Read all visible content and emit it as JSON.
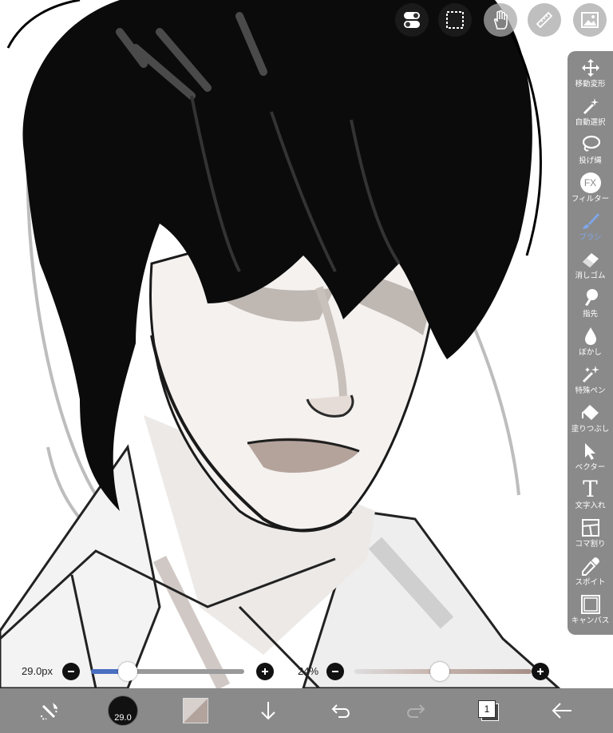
{
  "top_buttons": [
    {
      "name": "toggle-icon"
    },
    {
      "name": "selection-icon"
    },
    {
      "name": "hand-icon"
    },
    {
      "name": "ruler-icon"
    },
    {
      "name": "image-icon"
    }
  ],
  "tools": [
    {
      "label": "移動変形",
      "icon": "move-icon"
    },
    {
      "label": "自動選択",
      "icon": "magic-wand-icon"
    },
    {
      "label": "投げ縄",
      "icon": "lasso-icon"
    },
    {
      "label": "フィルター",
      "icon": "fx-icon"
    },
    {
      "label": "ブラシ",
      "icon": "brush-icon",
      "active": true
    },
    {
      "label": "消しゴム",
      "icon": "eraser-icon"
    },
    {
      "label": "指先",
      "icon": "finger-icon"
    },
    {
      "label": "ぼかし",
      "icon": "blur-icon"
    },
    {
      "label": "特殊ペン",
      "icon": "special-pen-icon"
    },
    {
      "label": "塗りつぶし",
      "icon": "fill-icon"
    },
    {
      "label": "ベクター",
      "icon": "vector-icon"
    },
    {
      "label": "文字入れ",
      "icon": "text-icon"
    },
    {
      "label": "コマ割り",
      "icon": "frame-divider-icon"
    },
    {
      "label": "スポイト",
      "icon": "eyedropper-icon"
    },
    {
      "label": "キャンバス",
      "icon": "canvas-icon"
    }
  ],
  "fx_text": "FX",
  "text_tool_glyph": "T",
  "brush_size": {
    "label": "29.0px",
    "value": 29.0,
    "fraction": 0.24
  },
  "opacity": {
    "label": "24%",
    "value": 24,
    "fraction": 0.12
  },
  "bottom": {
    "brush_size_badge": "29.0",
    "layer_count": "1"
  },
  "colors": {
    "accent": "#4a6fc0",
    "toolbar": "#8a8a8a",
    "active_tool": "#7fa6e8"
  }
}
